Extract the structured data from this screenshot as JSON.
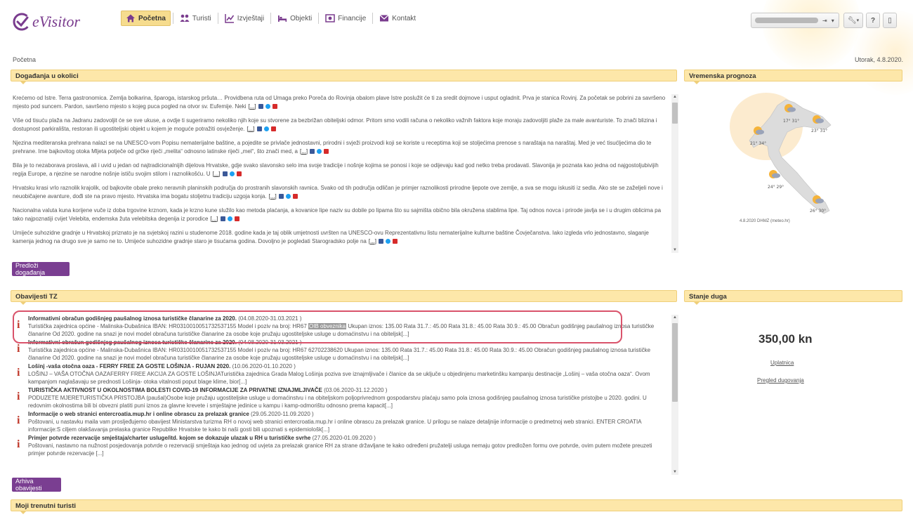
{
  "app": {
    "logo_text": "eVisitor",
    "brand_color": "#7a3c8e",
    "accent_color": "#fde7a9"
  },
  "nav": {
    "items": [
      {
        "label": "Početna",
        "icon": "home-icon",
        "active": true
      },
      {
        "label": "Turisti",
        "icon": "tourists-icon",
        "active": false
      },
      {
        "label": "Izvještaji",
        "icon": "reports-chart-icon",
        "active": false
      },
      {
        "label": "Objekti",
        "icon": "bed-icon",
        "active": false
      },
      {
        "label": "Financije",
        "icon": "money-icon",
        "active": false
      },
      {
        "label": "Kontakt",
        "icon": "mail-icon",
        "active": false
      }
    ]
  },
  "breadcrumb": "Početna",
  "date": "Utorak, 4.8.2020.",
  "events": {
    "title": "Događanja u okolici",
    "more_label": "[...]",
    "items": [
      "Krećemo od Istre. Terra gastronomica. Zemlja bolkarina, šparoga, istarskog pršuta… Providbena ruta od Umaga preko Poreča do Rovinja obalom plave Istre poslužit će ti za sredit dojmove i usput ogladnit. Prva je stanica Rovinj. Za početak se pobrini za savršeno mjesto pod suncem. Pardon, savršeno mjesto s kojeg puca pogled na otvor sv. Eufemije. Neki",
      "Više od tisuću plaža na Jadranu zadovoljit će se sve ukuse, a ovdje ti sugeriramo nekoliko njih koje su stvorene za bezbrižan obiteljski odmor. Pritom smo vodili računa o nekoliko važnih faktora koje moraju zadovoljiti plaže za male avanturiste. To znači blizina i dostupnost parkirališta, restoran ili ugostiteljski objekt u kojem je moguće potražiti osvježenje.",
      "Njezina mediteranska prehrana nalazi se na UNESCO-vom Popisu nematerijalne baštine, a pojedite se privlače jednostavni, prirodni i svježi proizvodi koji se koriste u receptima koji se stoljećima prenose s naraštaja na naraštaj. Med je već tisućljećima dio te prehrane. Ime bajkovitog otoka Mljeta potječe od grčke riječi „melita“ odnosno latinske riječi „mel“, što znači med, a",
      "Bila je to nezaborava proslava, ali i uvid u jedan od najtradicionalnijih dijelova Hrvatske, gdje svako slavonsko selo ima svoje tradicije i nošnje kojima se ponosi i koje se odijevaju kad god netko treba prodavati. Slavonija je poznata kao jedna od najgostoljubivijih regija Europe, a njezine se narodne nošnje ističu svojim stilom i raznolikošću. U",
      "Hrvatsku krasi vrlo raznolik krajolik, od bajkovite obale preko neravnih planinskih područja do prostranih slavonskih ravnica. Svako od tih područja odličan je primjer raznolikosti prirodne ljepote ove zemlje, a sva se mogu iskusiti iz sedla. Ako ste se zaželjeli nove i neuobičajene avanture, dođi ste na pravo mjesto. Hrvatska ima bogatu stoljetnu tradiciju uzgoja konja.",
      "Nacionalna valuta kuna korijene vuče iz doba trgovine krznom, kada je krzno kune služilo kao metoda plaćanja, a kovanice lipe naziv su dobile po lipama što su sajmišta obično bila okružena stablima lipe. Taj odnos novca i prirode javlja se i u drugim oblicima pa tako najpoznatiji cvijet Velebita, endemska žuta velebitska degenija iz porodice",
      "Umijeće suhozidne gradnje u Hrvatskoj priznato je na svjetskoj razini u studenome 2018. godine kada je taj oblik umjetnosti uvršten na UNESCO-ovu Reprezentativnu listu nematerijalne kulturne baštine Čovječanstva. Iako izgleda vrlo jednostavno, slaganje kamenja jednog na drugo sve je samo ne to. Umijeće suhozidne gradnje staro je tisućama godina. Dovoljno je pogledati Starogradsko polje na"
    ],
    "button_label": "Predloži događanja"
  },
  "weather": {
    "title": "Vremenska prognoza",
    "caption": "4.8.2020 DHMZ (meteo.hr)",
    "spots": [
      {
        "temp": "21° 34°"
      },
      {
        "temp": "17° 31°"
      },
      {
        "temp": "23° 31°"
      },
      {
        "temp": "24° 29°"
      },
      {
        "temp": "26° 30°"
      }
    ]
  },
  "notices": {
    "title": "Obavijesti TZ",
    "items": [
      {
        "title": "Informativni obračun godišnjeg paušalnog iznosa turističke članarine za 2020.",
        "dates": "(04.08.2020-31.03.2021 )",
        "body_pre": "Turistička zajednica općine - Malinska-Dubašnica IBAN: HR0310010051732537155 Model i poziv na broj: HR67",
        "body_highlight": "OIB obveznika",
        "body_post": "Ukupan iznos: 135.00 Rata 31.7.: 45.00 Rata 31.8.: 45.00 Rata 30.9.: 45.00 Obračun godišnjeg paušalnog iznosa turističke članarine Od 2020. godine na snazi je novi model obračuna turističke članarine za osobe koje pružaju ugostiteljske usluge u domaćinstvu i na obiteljsk[...]"
      },
      {
        "title": "Informativni obračun godišnjeg paušalnog iznosa turističke članarine za 2020.",
        "dates": "(04.08.2020-31.03.2021 )",
        "body_pre": "Turistička zajednica općine - Malinska-Dubašnica IBAN: HR0310010051732537155 Model i poziv na broj: HR67 62702238620 Ukupan iznos: 135.00 Rata 31.7.: 45.00 Rata 31.8.: 45.00 Rata 30.9.: 45.00 Obračun godišnjeg paušalnog iznosa turističke članarine Od 2020. godine na snazi je novi model obračuna turističke članarine za osobe koje pružaju ugostiteljske usluge u domaćinstvu i na obiteljsk[...]",
        "body_highlight": "",
        "body_post": ""
      },
      {
        "title": "Lošinj -vaša otočna oaza - FERRY FREE ZA GOSTE LOŠINJA - RUJAN 2020.",
        "dates": "(10.06.2020-01.10.2020 )",
        "body_pre": "LOŠINJ – VAŠA OTOČNA OAZAFERRY FREE AKCIJA ZA GOSTE LOŠINJATuristička zajednica Grada Malog Lošinja poziva sve iznajmljivače i članice da se uključe u objedinjenu marketinšku kampanju destinacije „Lošinj – vaša otočna oaza“. Ovom kampanjom naglašavaju se prednosti Lošinja- otoka vitalnosti poput blage klime, bior[...]",
        "body_highlight": "",
        "body_post": ""
      },
      {
        "title": "TURISTIČKA AKTIVNOST U OKOLNOSTIMA BOLESTI COVID-19 INFORMACIJE ZA PRIVATNE IZNAJMLJIVAČE",
        "dates": "(03.06.2020-31.12.2020 )",
        "body_pre": "PODUZETE MJERETURISTIČKA PRISTOJBA (paušal)Osobe koje pružaju ugostiteljske usluge u domaćinstvu i na obiteljskom poljoprivrednom gospodarstvu plaćaju samo pola iznosa godišnjeg paušalnog iznosa turističke pristojbe u 2020. godini. U redovnim okolnostima bili bi obvezni platiti puni iznos za glavne krevete i smještajne jedinice u kampu i kamp-odmorištu odnosno prema kapacit[...]",
        "body_highlight": "",
        "body_post": ""
      },
      {
        "title": "Informacije o web stranici entercroatia.mup.hr i online obrascu za prelazak granice",
        "dates": "(29.05.2020-11.09.2020 )",
        "body_pre": "Poštovani, u nastavku maila vam prosljeđujemo obavijest Ministarstva turizma RH o novoj web stranici entercroatia.mup.hr i online obrascu za prelazak granice. U prilogu se nalaze detaljnije informacije o predmetnoj web stranici. ENTER CROATIA informacije:S ciljem olakšavanja prelaska granice Republike Hrvatske te kako bi naši gosti bili upoznati s epidemiološk[...]",
        "body_highlight": "",
        "body_post": ""
      },
      {
        "title": "Primjer potvrde rezervacije smještaja/charter usluge/itd. kojom se dokazuje ulazak u RH u turističke svrhe",
        "dates": "(27.05.2020-01.09.2020 )",
        "body_pre": "Poštovani, nastavno na nužnost posjedovanja potvrde o rezervaciji smještaja kao jednog od uvjeta za prelazak granice RH za strane državljane te kako određeni pružatelji usluga nemaju gotov predložen formu ove potvrde, ovim putem možete preuzeti primjer potvrde rezervacije [...]",
        "body_highlight": "",
        "body_post": ""
      }
    ],
    "button_label": "Arhiva obavijesti"
  },
  "debt": {
    "title": "Stanje duga",
    "amount": "350,00 kn",
    "link_pay": "Uplatnica",
    "link_overview": "Pregled dugovanja"
  },
  "tourists": {
    "title": "Moji trenutni turisti"
  }
}
